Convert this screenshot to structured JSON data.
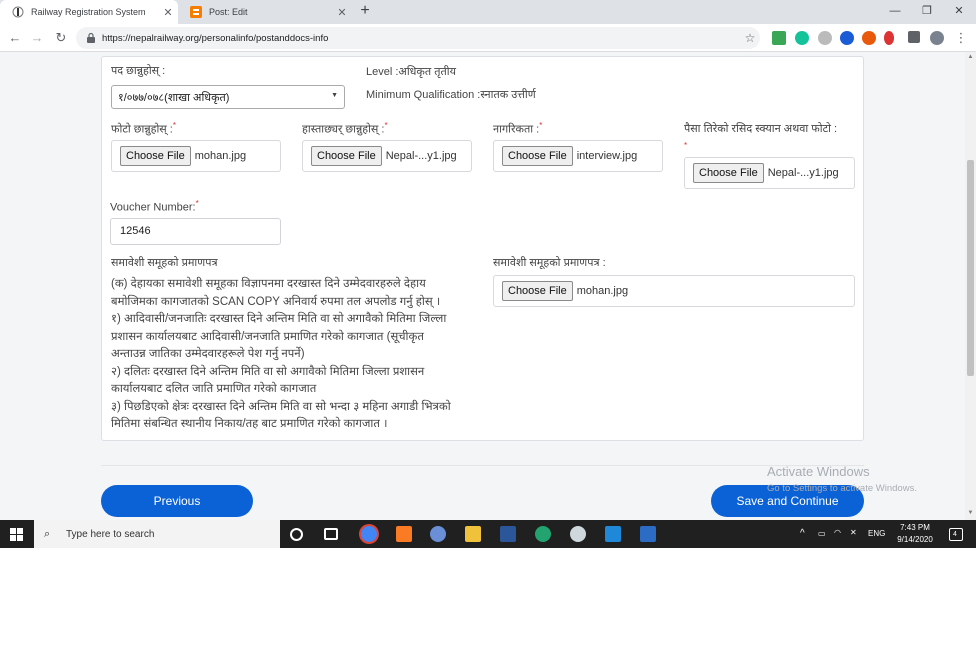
{
  "browser": {
    "tabs": [
      {
        "title": "Railway Registration System",
        "active": true
      },
      {
        "title": "Post: Edit",
        "active": false
      }
    ],
    "new_tab_symbol": "+",
    "window_controls": [
      "—",
      "❐",
      "✕"
    ],
    "url": "https://nepalrailway.org/personalinfo/postanddocs-info"
  },
  "form": {
    "post_label": "पद छान्नुहोस् :",
    "post_selected": "१/०७७/०७८(शाखा अधिकृत)",
    "level_text": "Level :अधिकृत तृतीय",
    "qualification_text": "Minimum Qualification :स्नातक उत्तीर्ण",
    "uploads": [
      {
        "label": "फोटो छान्नुहोस् :",
        "button": "Choose File",
        "file": "mohan.jpg"
      },
      {
        "label": "हास्ताछ्यर् छान्नुहोस् :",
        "button": "Choose File",
        "file": "Nepal-...y1.jpg"
      },
      {
        "label": "नागरिकता :",
        "button": "Choose File",
        "file": "interview.jpg"
      },
      {
        "label": "पैसा तिरेको रसिद स्क्यान अथवा फोटो :",
        "button": "Choose File",
        "file": "Nepal-...y1.jpg"
      }
    ],
    "required_mark": "*",
    "voucher_label": "Voucher Number:",
    "voucher_value": "12546",
    "inclusive_heading": "समावेशी समूहको प्रमाणपत्र",
    "inclusive_note": [
      "(क) देहायका समावेशी समूहका विज्ञापनमा दरखास्त दिने उम्मेदवारहरुले देहाय",
      "बमोजिमका कागजातको SCAN COPY अनिवार्य रुपमा तल अपलोड गर्नु होस् ।",
      "१) आदिवासी/जनजातिः दरखास्त दिने अन्तिम मिति वा सो अगावैको मितिमा जिल्ला",
      "प्रशासन कार्यालयबाट आदिवासी/जनजाति प्रमाणित गरेको कागजात (सूचीकृत",
      "अन्ताउन्न जातिका उम्मेदवारहरूले पेश गर्नु नपर्ने)",
      "२) दलितः दरखास्त दिने अन्तिम मिति वा सो अगावैको मितिमा जिल्ला प्रशासन",
      "कार्यालयबाट दलित जाति प्रमाणित गरेको कागजात",
      "३) पिछडिएको क्षेत्रः दरखास्त दिने अन्तिम मिति वा सो भन्दा ३ महिना अगाडी भित्रको",
      "मितिमा संबन्धित स्थानीय निकाय/तह बाट प्रमाणित गरेको कागजात ।"
    ],
    "inclusive_upload": {
      "label": "समावेशी समूहको प्रमाणपत्र :",
      "button": "Choose File",
      "file": "mohan.jpg"
    }
  },
  "actions": {
    "previous": "Previous",
    "save": "Save and Continue"
  },
  "watermark": {
    "line1": "Activate Windows",
    "line2": "Go to Settings to activate Windows."
  },
  "taskbar": {
    "search_placeholder": "Type here to search",
    "language": "ENG",
    "time": "7:43 PM",
    "date": "9/14/2020",
    "notification_count": "4"
  },
  "colors": {
    "primary_button": "#0b62d6",
    "taskbar": "#202020",
    "tab_strip": "#dee1e6"
  }
}
